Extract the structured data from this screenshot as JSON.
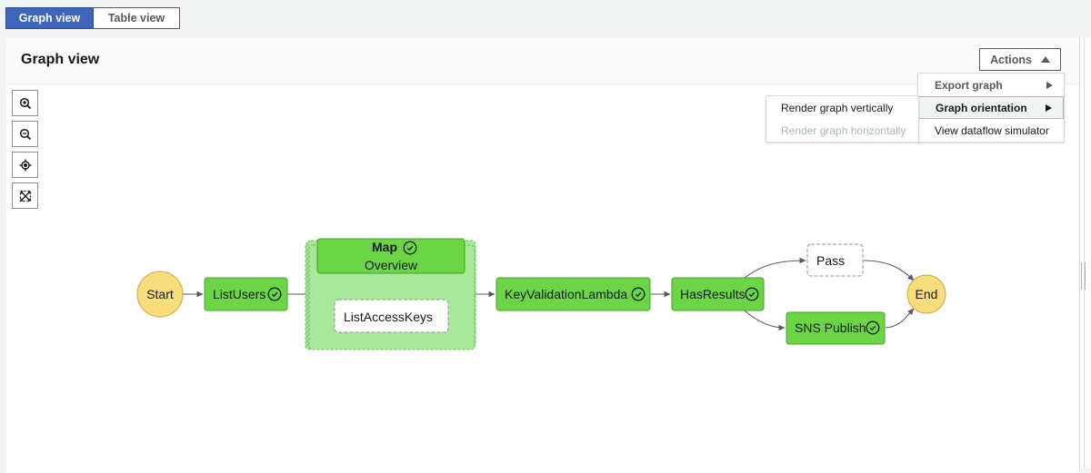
{
  "view_tabs": [
    {
      "label": "Graph view",
      "active": true
    },
    {
      "label": "Table view",
      "active": false
    }
  ],
  "panel": {
    "title": "Graph view",
    "actions_label": "Actions"
  },
  "actions_menu": [
    {
      "label": "Export graph",
      "has_submenu": true
    },
    {
      "label": "Graph orientation",
      "has_submenu": true,
      "highlighted": true
    },
    {
      "label": "View dataflow simulator",
      "has_submenu": false
    }
  ],
  "orientation_submenu": [
    {
      "label": "Render graph vertically",
      "enabled": true
    },
    {
      "label": "Render graph horizontally",
      "enabled": false
    }
  ],
  "zoom_controls": [
    {
      "icon": "zoom-in-icon"
    },
    {
      "icon": "zoom-out-icon"
    },
    {
      "icon": "center-icon"
    },
    {
      "icon": "fit-to-screen-icon"
    }
  ],
  "graph": {
    "colors": {
      "success_fill": "#6bd545",
      "success_stroke": "#4aa12b",
      "map_fill": "#a8e89a",
      "terminal_fill": "#f8dd7d",
      "terminal_stroke": "#c9a93e",
      "edge": "#545b64"
    },
    "nodes": {
      "start": "Start",
      "list_users": "ListUsers",
      "map_title": "Map",
      "map_subtitle": "Overview",
      "list_access_keys": "ListAccessKeys",
      "key_validation": "KeyValidationLambda",
      "has_results": "HasResults",
      "pass": "Pass",
      "sns_publish": "SNS Publish",
      "end": "End"
    },
    "statuses": {
      "list_users": "succeeded",
      "map": "succeeded",
      "list_access_keys": "not-run",
      "key_validation": "succeeded",
      "has_results": "succeeded",
      "pass": "not-run",
      "sns_publish": "succeeded"
    }
  }
}
